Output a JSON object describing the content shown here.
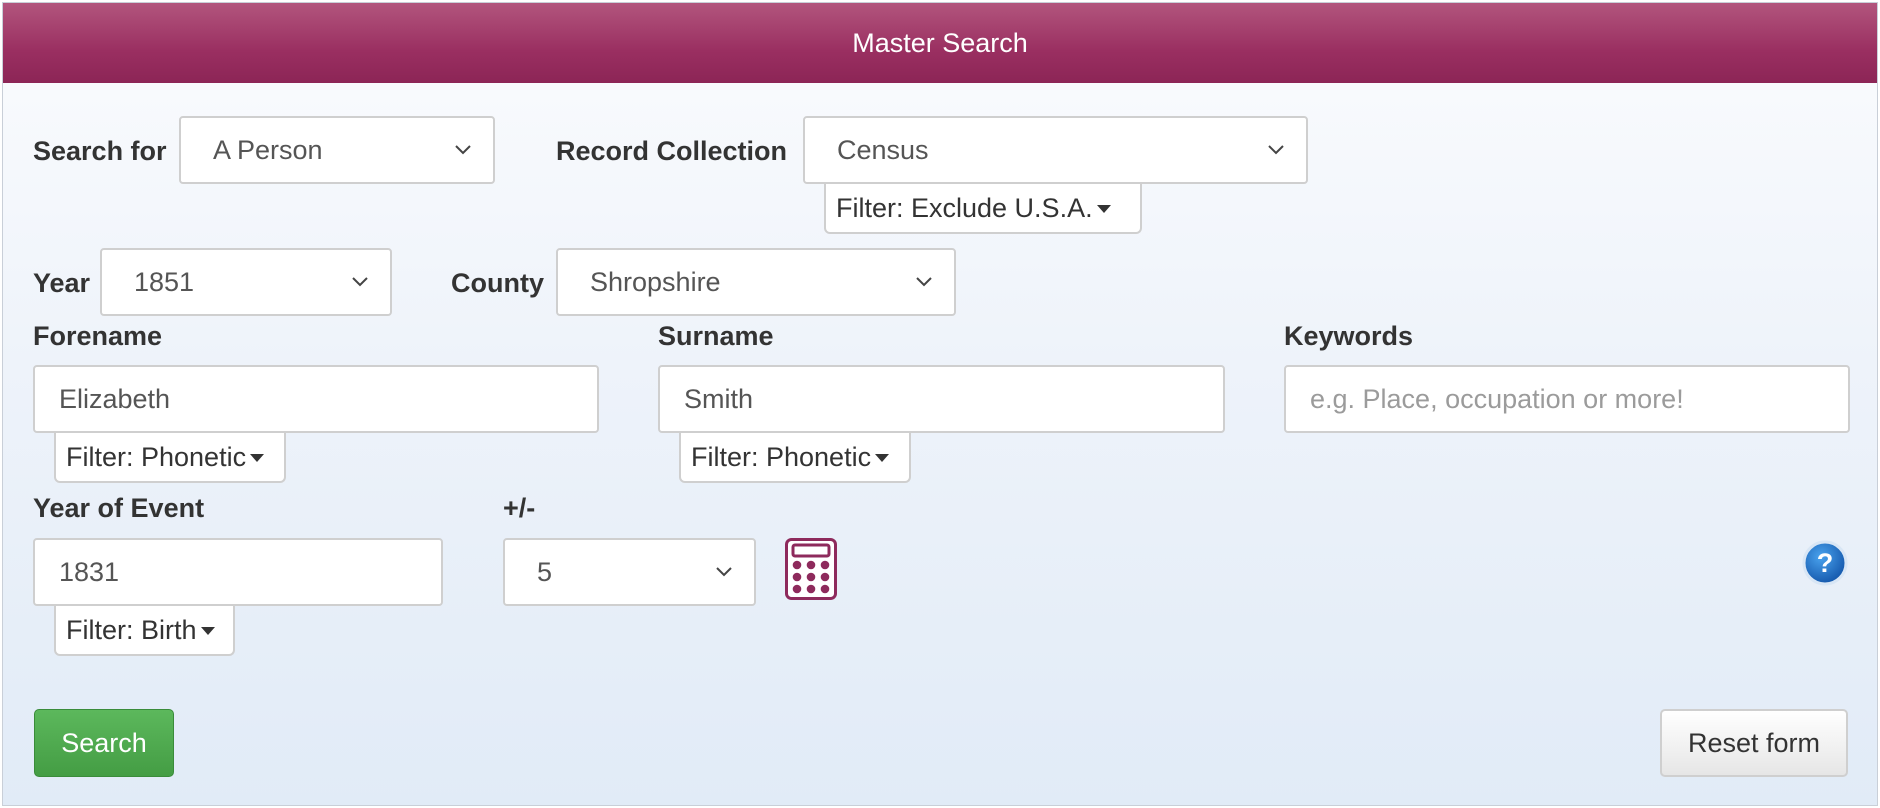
{
  "header": {
    "title": "Master Search"
  },
  "search_for": {
    "label": "Search for",
    "value": "A Person"
  },
  "record_collection": {
    "label": "Record Collection",
    "value": "Census",
    "filter": "Filter: Exclude U.S.A."
  },
  "year": {
    "label": "Year",
    "value": "1851"
  },
  "county": {
    "label": "County",
    "value": "Shropshire"
  },
  "forename": {
    "label": "Forename",
    "value": "Elizabeth",
    "filter": "Filter: Phonetic"
  },
  "surname": {
    "label": "Surname",
    "value": "Smith",
    "filter": "Filter: Phonetic"
  },
  "keywords": {
    "label": "Keywords",
    "value": "",
    "placeholder": "e.g. Place, occupation or more!"
  },
  "year_of_event": {
    "label": "Year of Event",
    "value": "1831",
    "filter": "Filter: Birth"
  },
  "plus_minus": {
    "label": "+/-",
    "value": "5"
  },
  "icons": {
    "calculator": "calculator-icon",
    "help": "help-icon"
  },
  "buttons": {
    "search": "Search",
    "reset": "Reset form"
  },
  "colors": {
    "header": "#9a2f61",
    "search_button": "#4cae4c",
    "help": "#1f6fc0",
    "calculator": "#8e2a5c"
  }
}
